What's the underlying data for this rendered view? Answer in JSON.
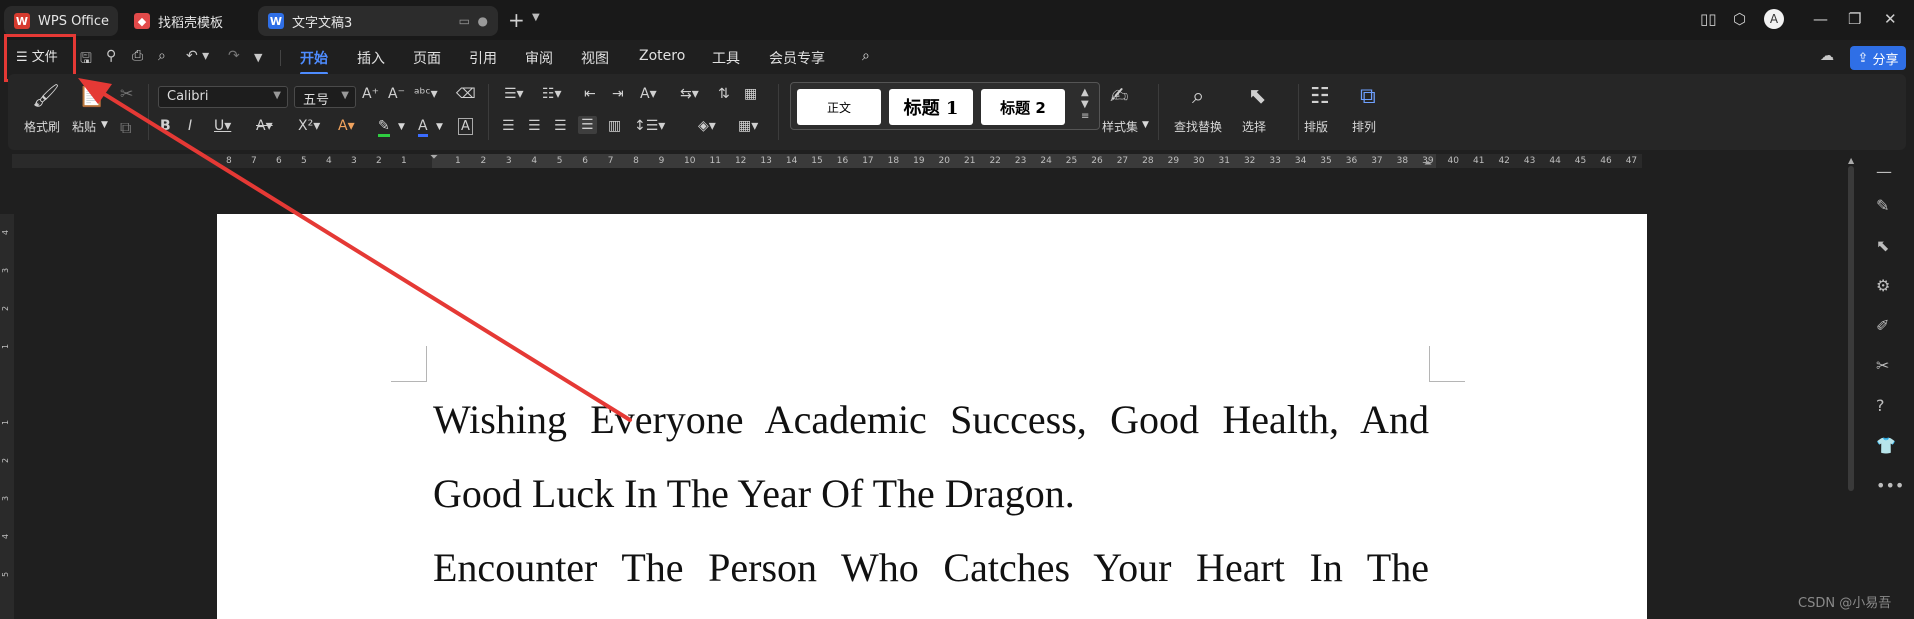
{
  "tabs": {
    "wps": "WPS Office",
    "template": "找稻壳模板",
    "document": "文字文稿3"
  },
  "menu": {
    "file": "文件",
    "tabs": [
      "开始",
      "插入",
      "页面",
      "引用",
      "审阅",
      "视图",
      "Zotero",
      "工具",
      "会员专享"
    ],
    "share": "分享"
  },
  "ribbon": {
    "format_painter": "格式刷",
    "paste": "粘贴",
    "font": "Calibri",
    "font_size": "五号",
    "styles": {
      "normal": "正文",
      "h1": "标题 1",
      "h2": "标题 2"
    },
    "style_set": "样式集",
    "find_replace": "查找替换",
    "select": "选择",
    "layout": "排版",
    "arrange": "排列"
  },
  "ruler": {
    "left": [
      "8",
      "7",
      "6",
      "5",
      "4",
      "3",
      "2",
      "1"
    ],
    "right": [
      "1",
      "2",
      "3",
      "4",
      "5",
      "6",
      "7",
      "8",
      "9",
      "10",
      "11",
      "12",
      "13",
      "14",
      "15",
      "16",
      "17",
      "18",
      "19",
      "20",
      "21",
      "22",
      "23",
      "24",
      "25",
      "26",
      "27",
      "28",
      "29",
      "30",
      "31",
      "32",
      "33",
      "34",
      "35",
      "36",
      "37",
      "38",
      "39",
      "40",
      "41",
      "42",
      "43",
      "44",
      "45",
      "46",
      "47"
    ]
  },
  "document": {
    "line1": "Wishing Everyone Academic Success, Good Health, And",
    "line2": "Good Luck In The Year Of The Dragon.",
    "line3": "Encounter The Person Who Catches Your Heart In The"
  },
  "watermark": "CSDN @小易吾",
  "colors": {
    "accent": "#4e8cff",
    "annotation": "#e53935",
    "share": "#2f6fe6"
  }
}
